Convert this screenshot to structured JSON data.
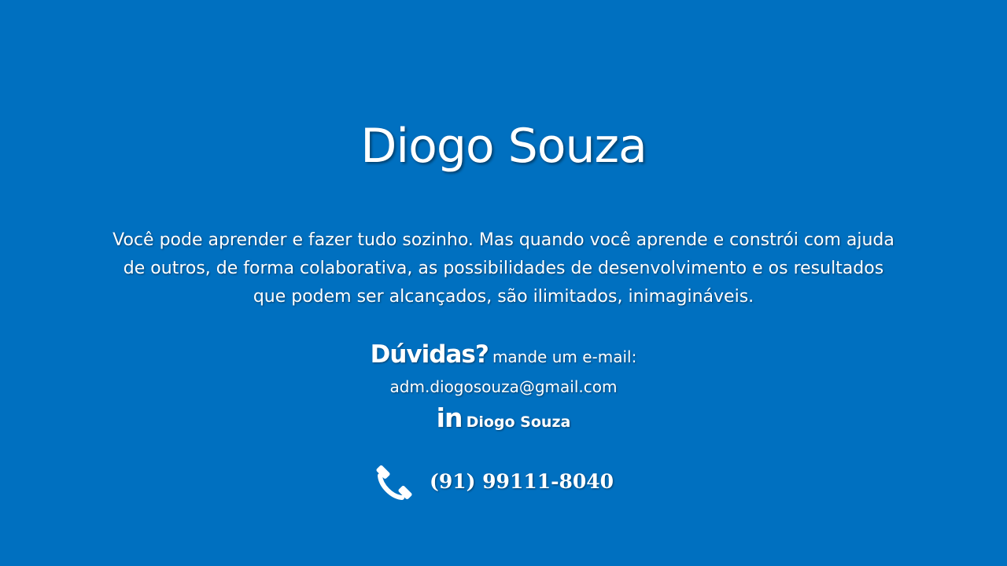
{
  "slide": {
    "background_color": "#0070c0",
    "text_color": "#ffffff",
    "title": "Diogo Souza",
    "quote": "Você pode aprender e fazer tudo sozinho. Mas quando você aprende e constrói com ajuda de outros, de forma colaborativa, as possibilidades de desenvolvimento e os resultados que podem ser alcançados, são ilimitados, inimagináveis.",
    "contact": {
      "question_label": "Dúvidas?",
      "question_text": "mande um e-mail:",
      "email": "adm.diogosouza@gmail.com",
      "linkedin_icon_text": "in",
      "linkedin_name": "Diogo Souza",
      "phone_icon": "phone-icon",
      "phone": "(91) 99111-8040"
    }
  }
}
